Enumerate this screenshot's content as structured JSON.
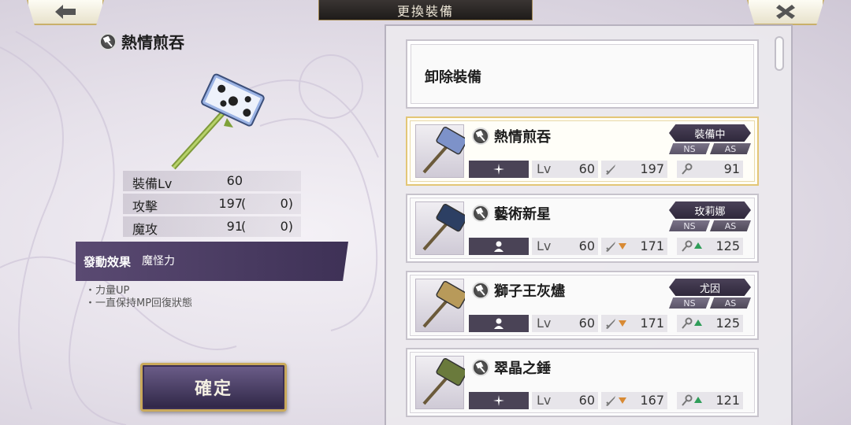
{
  "header": {
    "title": "更換裝備"
  },
  "icons": {
    "back": "back-arrow-icon",
    "close": "close-x-icon",
    "weapon_type": "hammer-type-icon"
  },
  "detail": {
    "name": "熱情煎吞",
    "stats": [
      {
        "label": "裝備Lv",
        "value": "60",
        "bonus_open": "",
        "bonus": ""
      },
      {
        "label": "攻擊",
        "value": "197",
        "bonus_open": "(",
        "bonus": "0)"
      },
      {
        "label": "魔攻",
        "value": "91",
        "bonus_open": "(",
        "bonus": "0)"
      }
    ],
    "skill_label": "發動效果",
    "skill_name": "魔怪力",
    "skill_effects": [
      "・力量UP",
      "・一直保持MP回復狀態"
    ],
    "confirm_label": "確定"
  },
  "list": {
    "unequip_label": "卸除裝備",
    "items": [
      {
        "name": "熱情煎吞",
        "tag": "裝備中",
        "ns": "NS",
        "as": "AS",
        "lv_label": "Lv",
        "lv": "60",
        "atk": "197",
        "mag": "91",
        "atk_trend": "none",
        "mag_trend": "none",
        "attr_icon": "sparkle-icon",
        "selected": true,
        "head_color": "#7d92c9"
      },
      {
        "name": "藝術新星",
        "tag": "玫莉娜",
        "ns": "NS",
        "as": "AS",
        "lv_label": "Lv",
        "lv": "60",
        "atk": "171",
        "mag": "125",
        "atk_trend": "down",
        "mag_trend": "up",
        "attr_icon": "person-icon",
        "selected": false,
        "head_color": "#2c3f63"
      },
      {
        "name": "獅子王灰燼",
        "tag": "尤因",
        "ns": "NS",
        "as": "AS",
        "lv_label": "Lv",
        "lv": "60",
        "atk": "171",
        "mag": "125",
        "atk_trend": "down",
        "mag_trend": "up",
        "attr_icon": "person-icon",
        "selected": false,
        "head_color": "#b89a5a"
      },
      {
        "name": "翠晶之錘",
        "tag": "",
        "ns": "",
        "as": "",
        "lv_label": "Lv",
        "lv": "60",
        "atk": "167",
        "mag": "121",
        "atk_trend": "down",
        "mag_trend": "up",
        "attr_icon": "sparkle-icon",
        "selected": false,
        "head_color": "#6a7a3c"
      }
    ]
  },
  "colors": {
    "accent_gold": "#c9a95b",
    "panel_purple": "#4a4356",
    "trend_up": "#2f9d59",
    "trend_down": "#d88a34"
  }
}
